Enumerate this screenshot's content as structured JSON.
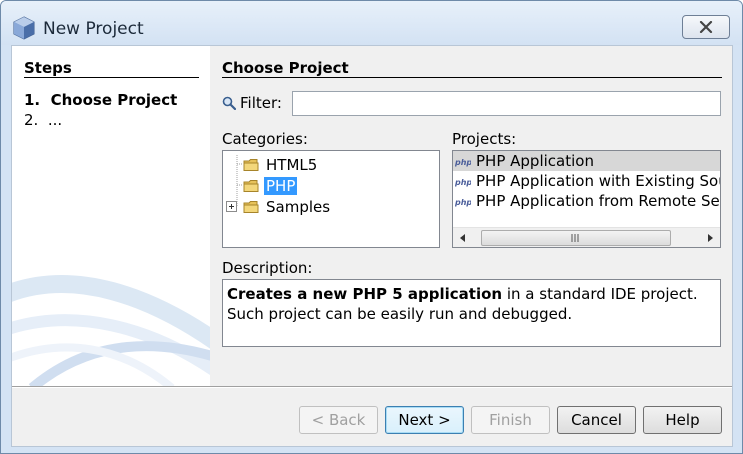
{
  "window": {
    "title": "New Project",
    "close_icon": "close-icon"
  },
  "steps": {
    "title": "Steps",
    "items": [
      {
        "number": "1.",
        "label": "Choose Project",
        "current": true
      },
      {
        "number": "2.",
        "label": "...",
        "current": false
      }
    ]
  },
  "main": {
    "title": "Choose Project",
    "filter": {
      "label": "Filter:",
      "value": "",
      "placeholder": ""
    },
    "categories": {
      "label": "Categories:",
      "items": [
        {
          "label": "HTML5",
          "expandable": false,
          "selected": false
        },
        {
          "label": "PHP",
          "expandable": false,
          "selected": true
        },
        {
          "label": "Samples",
          "expandable": true,
          "selected": false
        }
      ]
    },
    "projects": {
      "label": "Projects:",
      "items": [
        {
          "label": "PHP Application",
          "selected": true
        },
        {
          "label": "PHP Application with Existing Sources",
          "selected": false
        },
        {
          "label": "PHP Application from Remote Server",
          "selected": false
        }
      ]
    },
    "description": {
      "label": "Description:",
      "bold": "Creates a new PHP 5 application",
      "rest": " in a standard IDE project. Such project can be easily run and debugged."
    }
  },
  "buttons": {
    "back": "< Back",
    "next": "Next >",
    "finish": "Finish",
    "cancel": "Cancel",
    "help": "Help"
  },
  "colors": {
    "selection": "#3399ff",
    "frame": "#d4e3f4",
    "dialog_bg": "#f0f0f0"
  }
}
